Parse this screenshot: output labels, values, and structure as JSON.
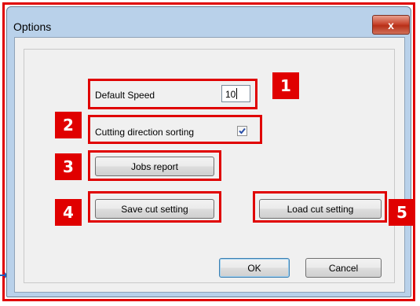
{
  "window": {
    "title": "Options",
    "close_glyph": "x"
  },
  "fields": {
    "default_speed_label": "Default Speed",
    "default_speed_value": "10",
    "cutting_sorting_label": "Cutting direction sorting",
    "cutting_sorting_checked": true
  },
  "buttons": {
    "jobs_report": "Jobs report",
    "save_cut_setting": "Save cut setting",
    "load_cut_setting": "Load cut setting",
    "ok": "OK",
    "cancel": "Cancel"
  },
  "annotations": {
    "colors": {
      "accent": "#e00000"
    },
    "markers": [
      "1",
      "2",
      "3",
      "4",
      "5"
    ]
  }
}
